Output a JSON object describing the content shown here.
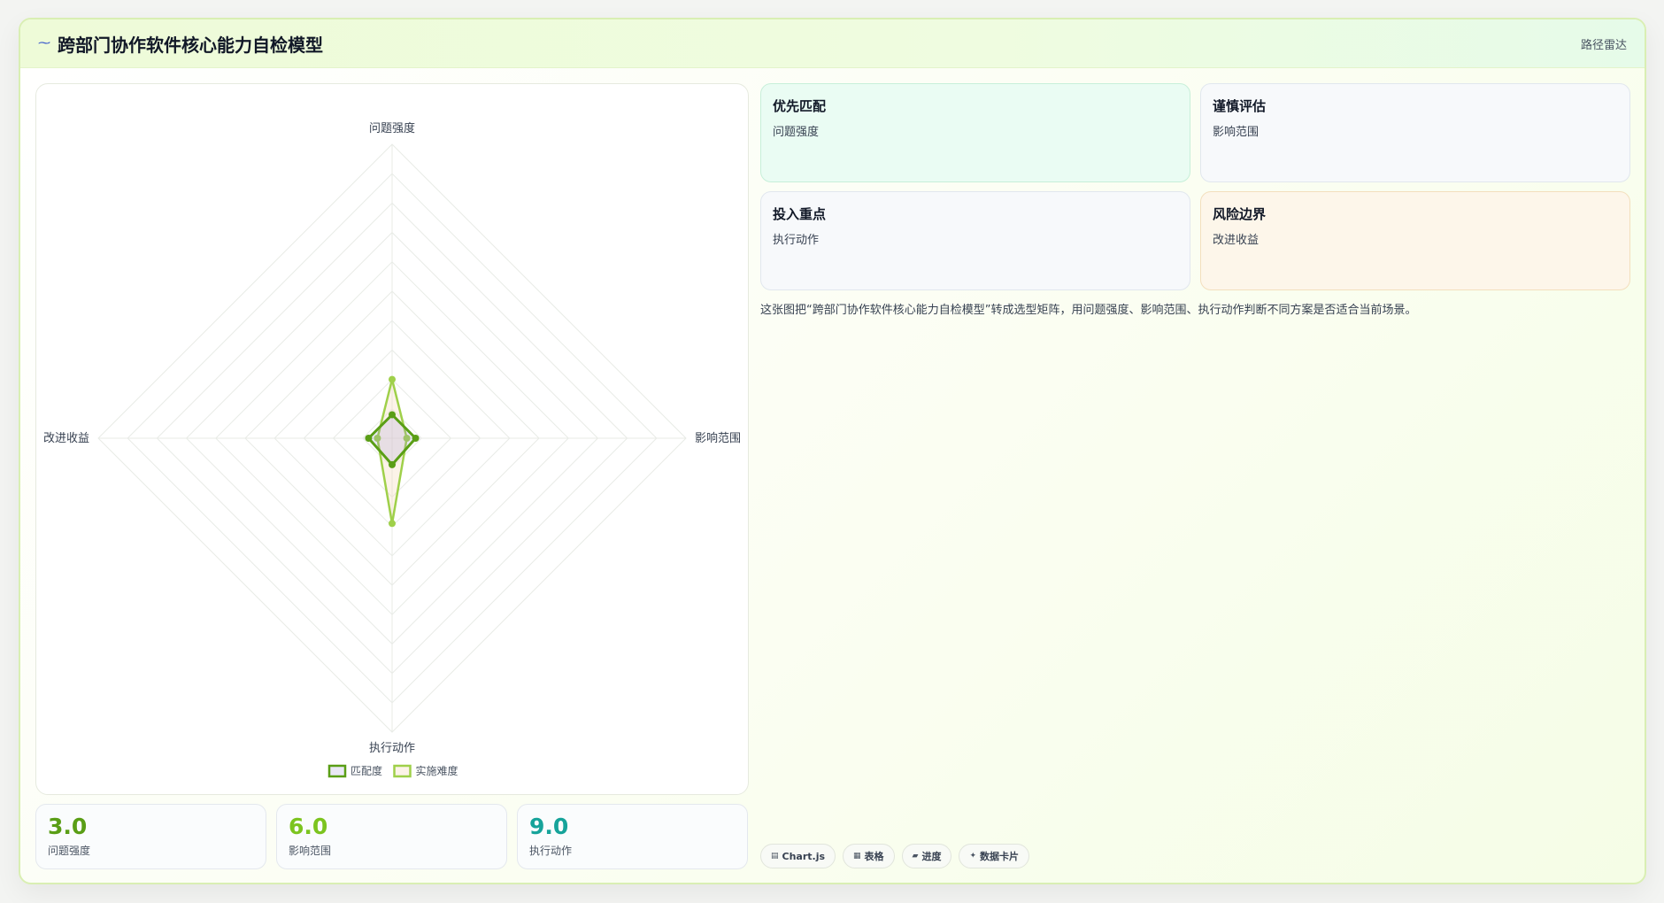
{
  "header": {
    "icon": "wave-icon",
    "title": "跨部门协作软件核心能力自检模型",
    "route_label": "路径雷达"
  },
  "stats": [
    {
      "value": "3.0",
      "label": "问题强度",
      "color": "#5a9e16"
    },
    {
      "value": "6.0",
      "label": "影响范围",
      "color": "#7cc41f"
    },
    {
      "value": "9.0",
      "label": "执行动作",
      "color": "#16a39a"
    }
  ],
  "cards": [
    {
      "title": "优先匹配",
      "subtitle": "问题强度",
      "bg": "#eafcf3",
      "border": "#c7efd9"
    },
    {
      "title": "谨慎评估",
      "subtitle": "影响范围",
      "bg": "#f7f9fb",
      "border": "#e1e7ee"
    },
    {
      "title": "投入重点",
      "subtitle": "执行动作",
      "bg": "#f7f9fb",
      "border": "#e1e7ee"
    },
    {
      "title": "风险边界",
      "subtitle": "改进收益",
      "bg": "#fdf6ea",
      "border": "#f3dfbd"
    }
  ],
  "description": "这张图把“跨部门协作软件核心能力自检模型”转成选型矩阵，用问题强度、影响范围、执行动作判断不同方案是否适合当前场景。",
  "tags": [
    {
      "icon": "chart-icon",
      "glyph": "▤",
      "label": "Chart.js"
    },
    {
      "icon": "table-icon",
      "glyph": "▦",
      "label": "表格"
    },
    {
      "icon": "progress-icon",
      "glyph": "▰",
      "label": "进度"
    },
    {
      "icon": "sparkle-icon",
      "glyph": "✦",
      "label": "数据卡片"
    }
  ],
  "chart_data": {
    "type": "radar",
    "axes": [
      "问题强度",
      "影响范围",
      "执行动作",
      "改进收益"
    ],
    "scale": {
      "min": 0,
      "max": 10,
      "step": 1
    },
    "series": [
      {
        "name": "匹配度",
        "values": [
          0.8,
          0.8,
          0.9,
          0.8
        ],
        "color": "#5a9e16",
        "fill": "rgba(160,150,215,0.22)"
      },
      {
        "name": "实施难度",
        "values": [
          2.0,
          0.5,
          2.9,
          0.5
        ],
        "color": "#9fd04a",
        "fill": "rgba(246,220,190,0.35)"
      }
    ],
    "legend_position": "bottom",
    "grid": true
  }
}
